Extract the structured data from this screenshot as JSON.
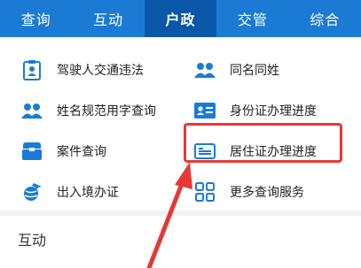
{
  "tabs": [
    {
      "label": "查询",
      "active": false
    },
    {
      "label": "互动",
      "active": false
    },
    {
      "label": "户政",
      "active": true
    },
    {
      "label": "交管",
      "active": false
    },
    {
      "label": "综合",
      "active": false
    }
  ],
  "menu": {
    "items": [
      {
        "label": "驾驶人交通违法",
        "icon": "driver-clipboard-icon"
      },
      {
        "label": "同名同姓",
        "icon": "people-icon"
      },
      {
        "label": "姓名规范用字查询",
        "icon": "people-icon"
      },
      {
        "label": "身份证办理进度",
        "icon": "id-card-icon"
      },
      {
        "label": "案件查询",
        "icon": "folder-icon"
      },
      {
        "label": "居住证办理进度",
        "icon": "residence-card-icon"
      },
      {
        "label": "出入境办证",
        "icon": "globe-plane-icon"
      },
      {
        "label": "更多查询服务",
        "icon": "grid-icon"
      }
    ]
  },
  "section": {
    "title": "互动"
  },
  "colors": {
    "tab_bar": "#1b7bd4",
    "tab_active": "#0a57aa",
    "icon_blue": "#1b7bd4",
    "annotation_red": "#e53935"
  }
}
